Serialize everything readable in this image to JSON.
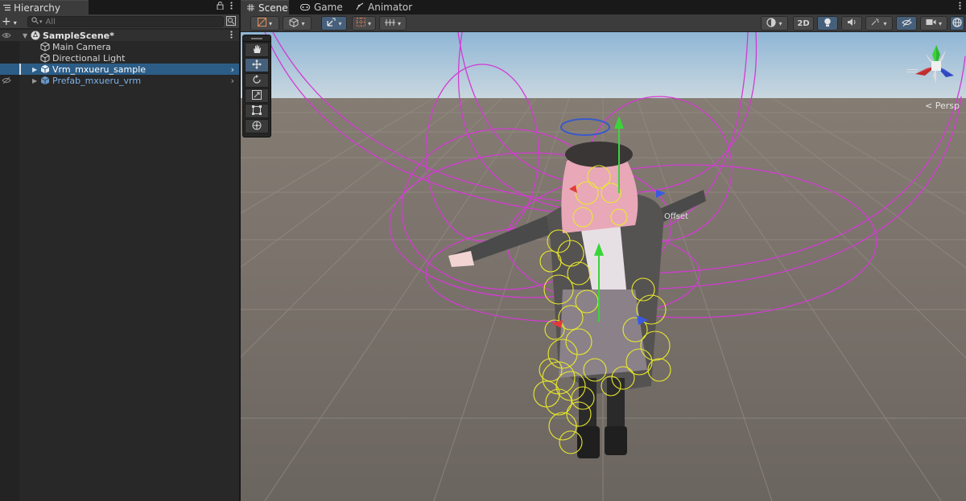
{
  "hierarchy": {
    "tab_label": "Hierarchy",
    "search_placeholder": "All",
    "add_label": "+",
    "scene_name": "SampleScene*",
    "items": [
      {
        "label": "Main Camera"
      },
      {
        "label": "Directional Light"
      },
      {
        "label": "Vrm_mxueru_sample"
      },
      {
        "label": "Prefab_mxueru_vrm"
      }
    ]
  },
  "scene_view": {
    "tabs": [
      {
        "label": "Scene"
      },
      {
        "label": "Game"
      },
      {
        "label": "Animator"
      }
    ],
    "toolbar": {
      "mode_2d_label": "2D"
    },
    "camera_label": "Persp",
    "offset_label": "Offset"
  },
  "colors": {
    "panel_bg": "#282828",
    "selection": "#2c5d87",
    "prefab_text": "#7cb3ea",
    "active_tool": "#46607c",
    "collider_magenta": "#d43ad4",
    "collider_yellow": "#eaea2a",
    "gizmo_x": "#e23a3a",
    "gizmo_y": "#3ad43a",
    "gizmo_z": "#3a5ae2"
  }
}
